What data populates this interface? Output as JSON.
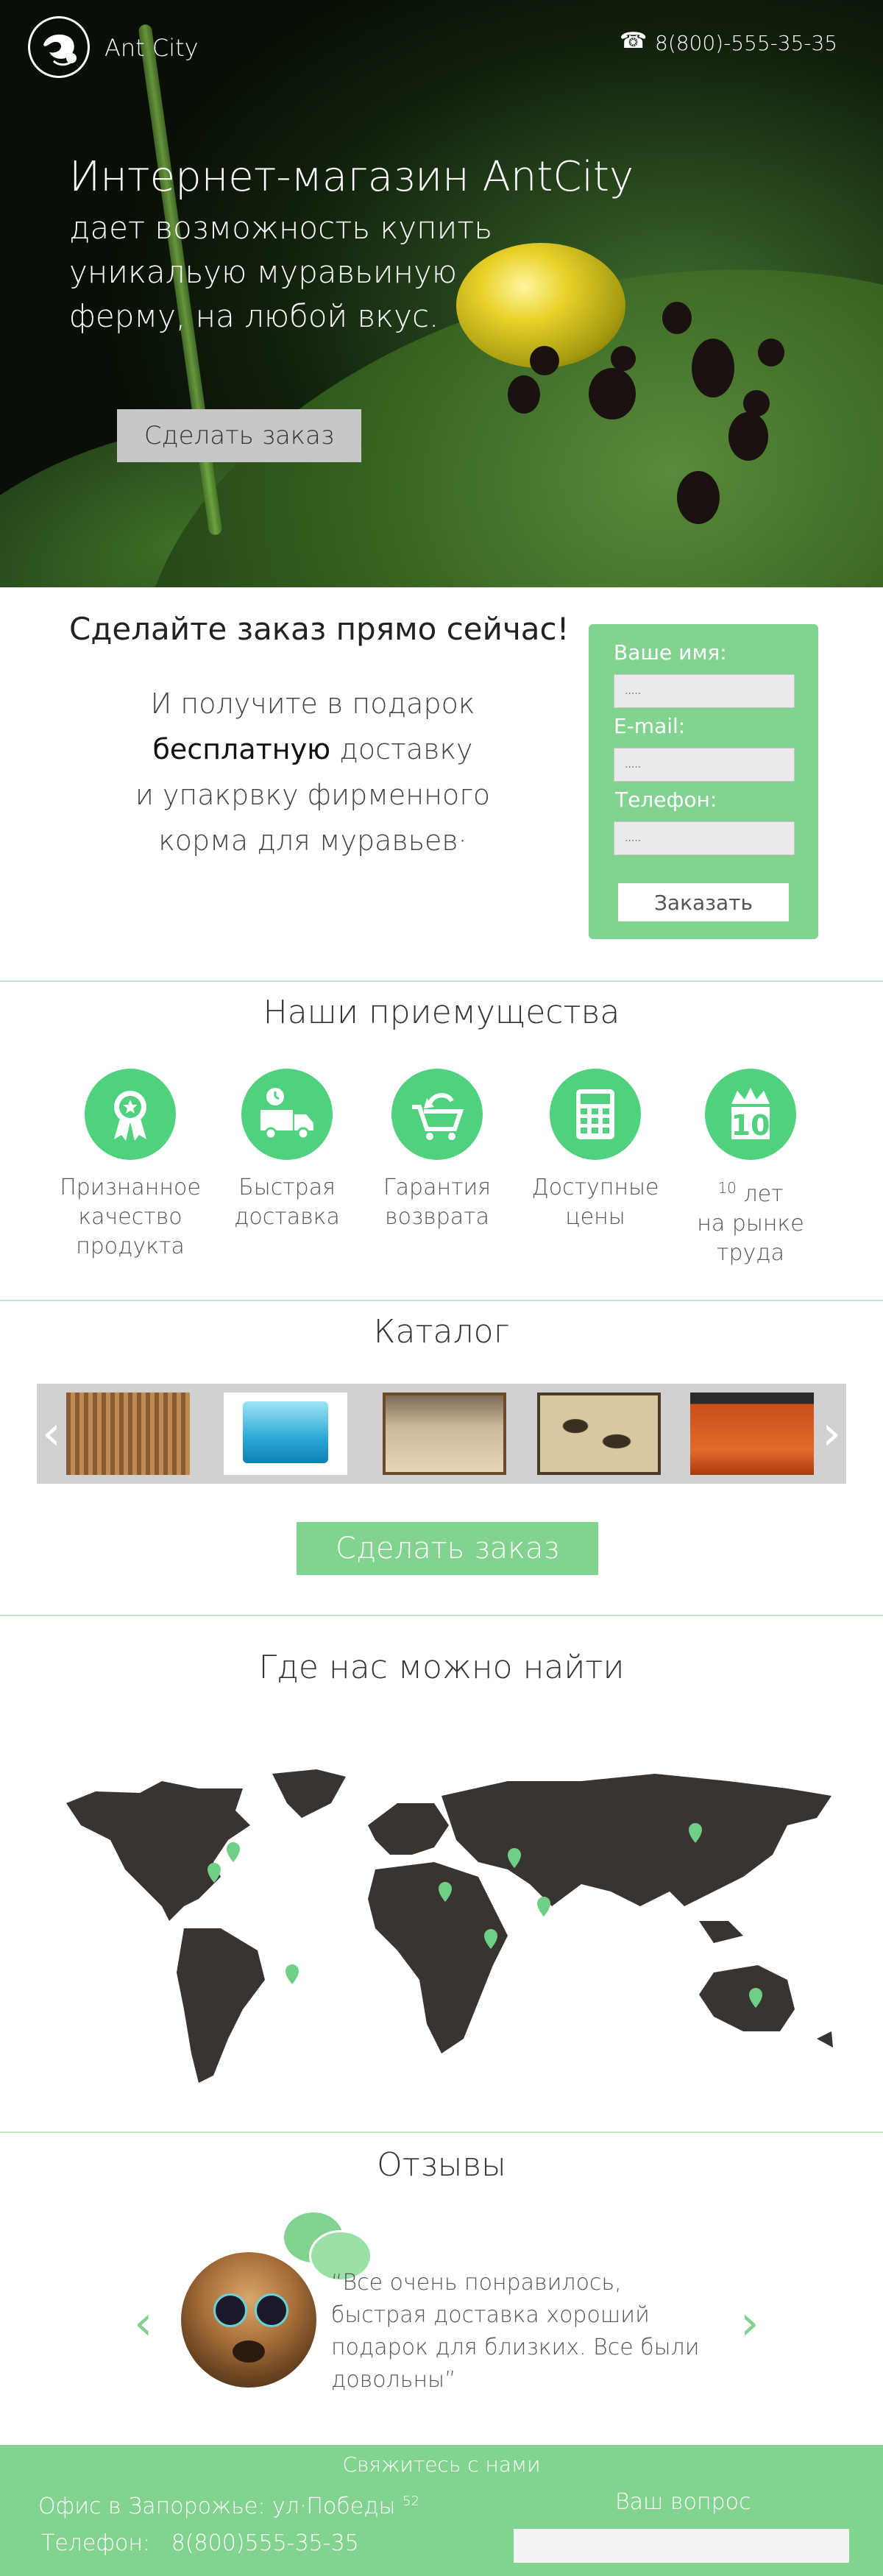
{
  "header": {
    "brand": "Ant City",
    "phone": "8(800)-555-35-35",
    "logo_icon": "ant-logo-icon",
    "phone_icon": "telephone-icon"
  },
  "hero": {
    "title": "Интернет-магазин AntCity",
    "subtitle": "дает возможность купить уникальую муравьиную ферму, на любой вкус.",
    "button": "Сделать заказ"
  },
  "order": {
    "heading": "Сделайте заказ прямо сейчас!",
    "text_line1": "И получите в подарок",
    "text_bold": "бесплатную",
    "text_line2_rest": " доставку",
    "text_line3": "и упакрвку фирменного",
    "text_line4": "корма для муравьев·",
    "form": {
      "name_label": "Ваше имя:",
      "name_placeholder": ".....",
      "email_label": "E-mail:",
      "email_placeholder": ".....",
      "phone_label": "Телефон:",
      "phone_placeholder": ".....",
      "submit": "Заказать"
    }
  },
  "advantages": {
    "title": "Наши приемущества",
    "items": [
      {
        "icon": "award-ribbon-icon",
        "label_lines": [
          "Признанное",
          "качество",
          "продукта"
        ]
      },
      {
        "icon": "delivery-truck-icon",
        "label_lines": [
          "Быстрая",
          "доставка"
        ]
      },
      {
        "icon": "cart-return-icon",
        "label_lines": [
          "Гарантия",
          "возврата"
        ]
      },
      {
        "icon": "calculator-icon",
        "label_lines": [
          "Доступные",
          "цены"
        ]
      },
      {
        "icon": "crown-ten-icon",
        "sup": "10",
        "label_lines": [
          " лет",
          "на рынке",
          "труда"
        ]
      }
    ]
  },
  "catalog": {
    "title": "Каталог",
    "prev_icon": "chevron-left-icon",
    "next_icon": "chevron-right-icon",
    "prev_glyph": "‹",
    "next_glyph": "›",
    "button": "Сделать заказ"
  },
  "map_section": {
    "title": "Где нас можно найти",
    "marker_icon": "map-pin-icon",
    "marker_color": "#6fcf84"
  },
  "reviews": {
    "title": "Отзывы",
    "text": "“Все очень понравилось, быстрая доставка хороший подарок для близких. Все были довольны”",
    "prev_glyph": "‹",
    "next_glyph": "›"
  },
  "footer": {
    "title": "Свяжитесь с нами",
    "office": "Офис в Запорожье: ул·Победы",
    "office_sup": "52",
    "phone_label": "Телефон:",
    "phone": "8(800)555-35-35",
    "question_label": "Ваш вопрос"
  },
  "colors": {
    "accent": "#82d38f",
    "icon_green": "#4fd17e",
    "divider": "#bfe8c6"
  }
}
